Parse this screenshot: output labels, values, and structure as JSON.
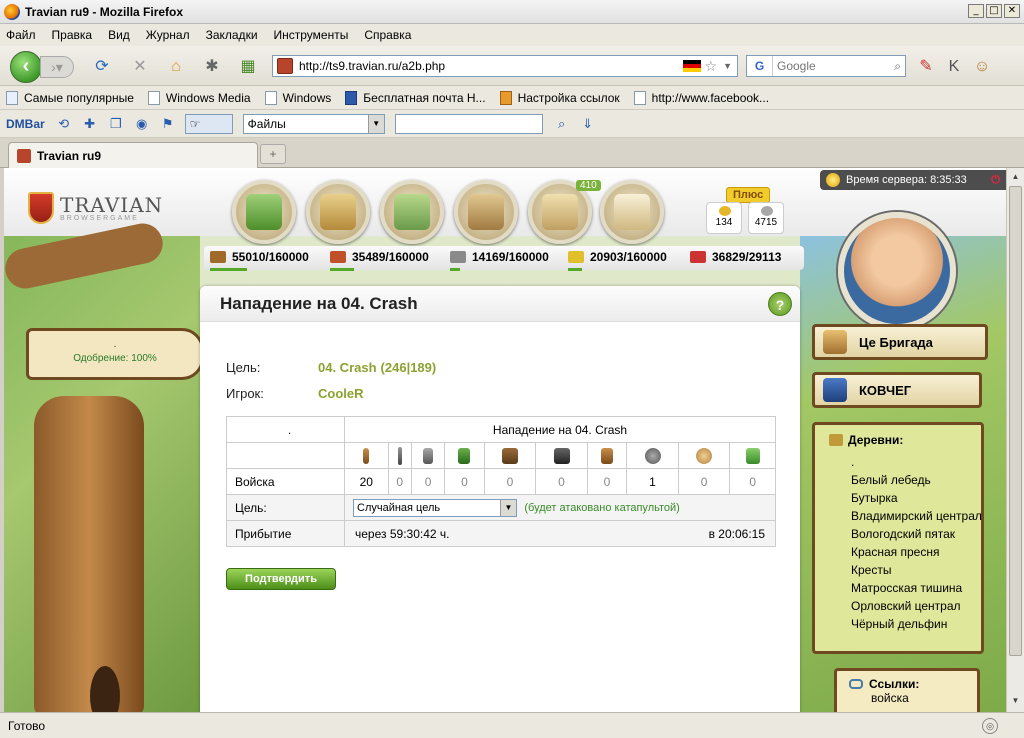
{
  "window": {
    "title": "Travian ru9 - Mozilla Firefox",
    "min": "_",
    "max": "□",
    "close": "✕"
  },
  "menu": [
    "Файл",
    "Правка",
    "Вид",
    "Журнал",
    "Закладки",
    "Инструменты",
    "Справка"
  ],
  "nav": {
    "url": "http://ts9.travian.ru/a2b.php",
    "search_placeholder": "Google",
    "search_engine": "G"
  },
  "bookmarks": [
    "Самые популярные",
    "Windows Media",
    "Windows",
    "Бесплатная почта Н...",
    "Настройка ссылок",
    "http://www.facebook..."
  ],
  "dmbar": {
    "label": "DMBar",
    "files_select": "Файлы"
  },
  "tab": {
    "title": "Travian ru9",
    "new_tab": "+"
  },
  "game": {
    "logo": "TRAVIAN",
    "logo_sub": "BROWSERGAME",
    "server_time": "Время сервера: 8:35:33",
    "badge": "410",
    "plus": "Плюс",
    "gold": "134",
    "silver": "4715",
    "resources": [
      {
        "name": "wood",
        "value": "55010/160000",
        "fill": 0.34,
        "color": "#a06a2a"
      },
      {
        "name": "clay",
        "value": "35489/160000",
        "fill": 0.22,
        "color": "#c0502a"
      },
      {
        "name": "iron",
        "value": "14169/160000",
        "fill": 0.09,
        "color": "#8a8a8a"
      },
      {
        "name": "crop",
        "value": "20903/160000",
        "fill": 0.13,
        "color": "#e0c02a"
      }
    ],
    "consumption": "36829/29113",
    "approval": "Одобрение: 100%",
    "approval_dot": "."
  },
  "panel": {
    "title": "Нападение на 04. Crash",
    "help": "?",
    "target_label": "Цель:",
    "target_value": "04. Crash",
    "target_coords": "(246|189)",
    "player_label": "Игрок:",
    "player_value": "CooleR",
    "table": {
      "corner": ".",
      "header": "Нападение на 04. Crash",
      "unit_icons": [
        "clubswinger-icon",
        "spearman-icon",
        "axeman-icon",
        "scout-icon",
        "paladin-icon",
        "teutonic-knight-icon",
        "ram-icon",
        "catapult-icon",
        "chief-icon",
        "settler-icon"
      ],
      "troops_label": "Войска",
      "troops": [
        "20",
        "0",
        "0",
        "0",
        "0",
        "0",
        "0",
        "1",
        "0",
        "0"
      ],
      "target_row_label": "Цель:",
      "target_select": "Случайная цель",
      "target_note": "(будет атаковано катапультой)",
      "arrival_label": "Прибытие",
      "arrival_in": "через 59:30:42 ч.",
      "arrival_at": "в 20:06:15"
    },
    "confirm": "Подтвердить"
  },
  "sidebar": {
    "alliance": "Це Бригада",
    "village_sign": "КОВЧЕГ",
    "villages_title": "Деревни:",
    "villages": [
      ".",
      "Белый лебедь",
      "Бутырка",
      "Владимирский централ",
      "Вологодский пятак",
      "Красная пресня",
      "Кресты",
      "Матросская тишина",
      "Орловский централ",
      "Чёрный дельфин"
    ],
    "links_title": "Ссылки:",
    "links_first": "войска"
  },
  "status": "Готово"
}
